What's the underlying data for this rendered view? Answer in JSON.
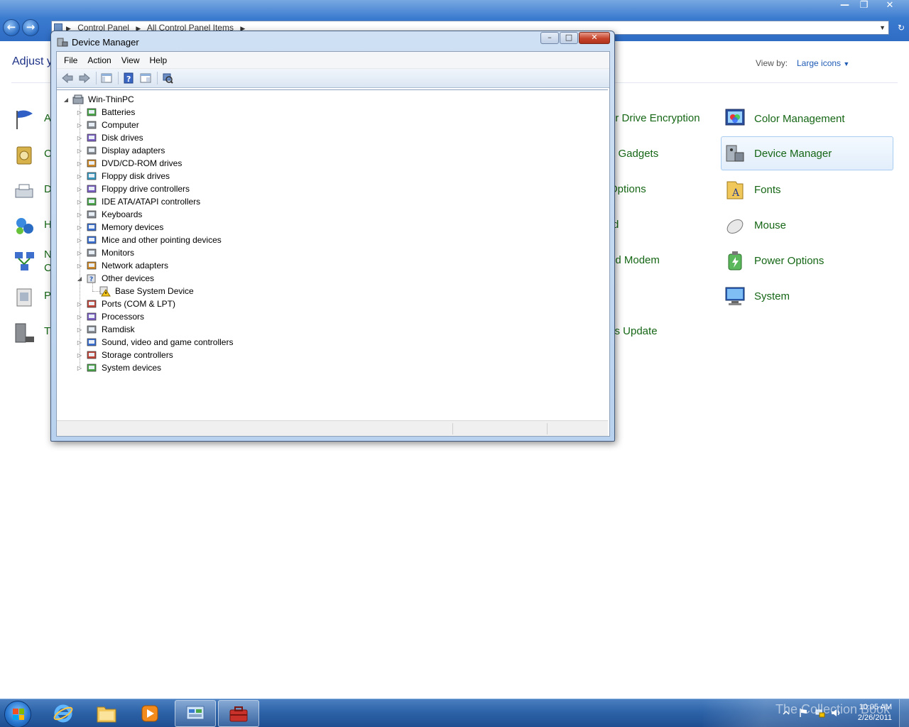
{
  "control_panel": {
    "breadcrumb": [
      "Control Panel",
      "All Control Panel Items"
    ],
    "heading": "Adjust y",
    "view_by_label": "View by:",
    "view_by_value": "Large icons",
    "left_column_labels": [
      "A",
      "C",
      "D",
      "H",
      "N",
      "C",
      "P",
      "T"
    ],
    "middle_column_labels": [
      "er Drive Encryption",
      "p Gadgets",
      "Options",
      "rd",
      "nd Modem",
      "vs Update"
    ],
    "right_column": [
      {
        "label": "Color Management",
        "icon": "color-management-icon"
      },
      {
        "label": "Device Manager",
        "icon": "device-manager-icon",
        "selected": true
      },
      {
        "label": "Fonts",
        "icon": "fonts-folder-icon"
      },
      {
        "label": "Mouse",
        "icon": "mouse-icon"
      },
      {
        "label": "Power Options",
        "icon": "power-options-icon"
      },
      {
        "label": "System",
        "icon": "system-icon"
      }
    ]
  },
  "device_manager": {
    "title": "Device Manager",
    "menu": [
      "File",
      "Action",
      "View",
      "Help"
    ],
    "tree": {
      "root": "Win-ThinPC",
      "categories": [
        {
          "label": "Batteries",
          "icon": "battery-icon",
          "expanded": false
        },
        {
          "label": "Computer",
          "icon": "computer-icon",
          "expanded": false
        },
        {
          "label": "Disk drives",
          "icon": "disk-drive-icon",
          "expanded": false
        },
        {
          "label": "Display adapters",
          "icon": "display-adapter-icon",
          "expanded": false
        },
        {
          "label": "DVD/CD-ROM drives",
          "icon": "dvd-drive-icon",
          "expanded": false
        },
        {
          "label": "Floppy disk drives",
          "icon": "floppy-disk-icon",
          "expanded": false
        },
        {
          "label": "Floppy drive controllers",
          "icon": "floppy-controller-icon",
          "expanded": false
        },
        {
          "label": "IDE ATA/ATAPI controllers",
          "icon": "ide-controller-icon",
          "expanded": false
        },
        {
          "label": "Keyboards",
          "icon": "keyboard-icon",
          "expanded": false
        },
        {
          "label": "Memory devices",
          "icon": "memory-icon",
          "expanded": false
        },
        {
          "label": "Mice and other pointing devices",
          "icon": "mouse-device-icon",
          "expanded": false
        },
        {
          "label": "Monitors",
          "icon": "monitor-icon",
          "expanded": false
        },
        {
          "label": "Network adapters",
          "icon": "network-adapter-icon",
          "expanded": false
        },
        {
          "label": "Other devices",
          "icon": "unknown-device-icon",
          "expanded": true,
          "children": [
            "Base System Device"
          ]
        },
        {
          "label": "Ports (COM & LPT)",
          "icon": "port-icon",
          "expanded": false
        },
        {
          "label": "Processors",
          "icon": "processor-icon",
          "expanded": false
        },
        {
          "label": "Ramdisk",
          "icon": "ramdisk-icon",
          "expanded": false
        },
        {
          "label": "Sound, video and game controllers",
          "icon": "sound-icon",
          "expanded": false
        },
        {
          "label": "Storage controllers",
          "icon": "storage-controller-icon",
          "expanded": false
        },
        {
          "label": "System devices",
          "icon": "system-device-icon",
          "expanded": false
        }
      ]
    }
  },
  "taskbar": {
    "watermark": "The Collection Book",
    "time": "10:05 AM",
    "date": "2/26/2011",
    "pinned": [
      "internet-explorer-icon",
      "windows-explorer-icon",
      "media-player-icon",
      "control-panel-icon",
      "device-manager-task-icon"
    ]
  },
  "colors": {
    "title_blue": "#3b7cd0",
    "link_green": "#156615",
    "heading_blue": "#1e3287",
    "taskbar_blue": "#2d63a8"
  }
}
